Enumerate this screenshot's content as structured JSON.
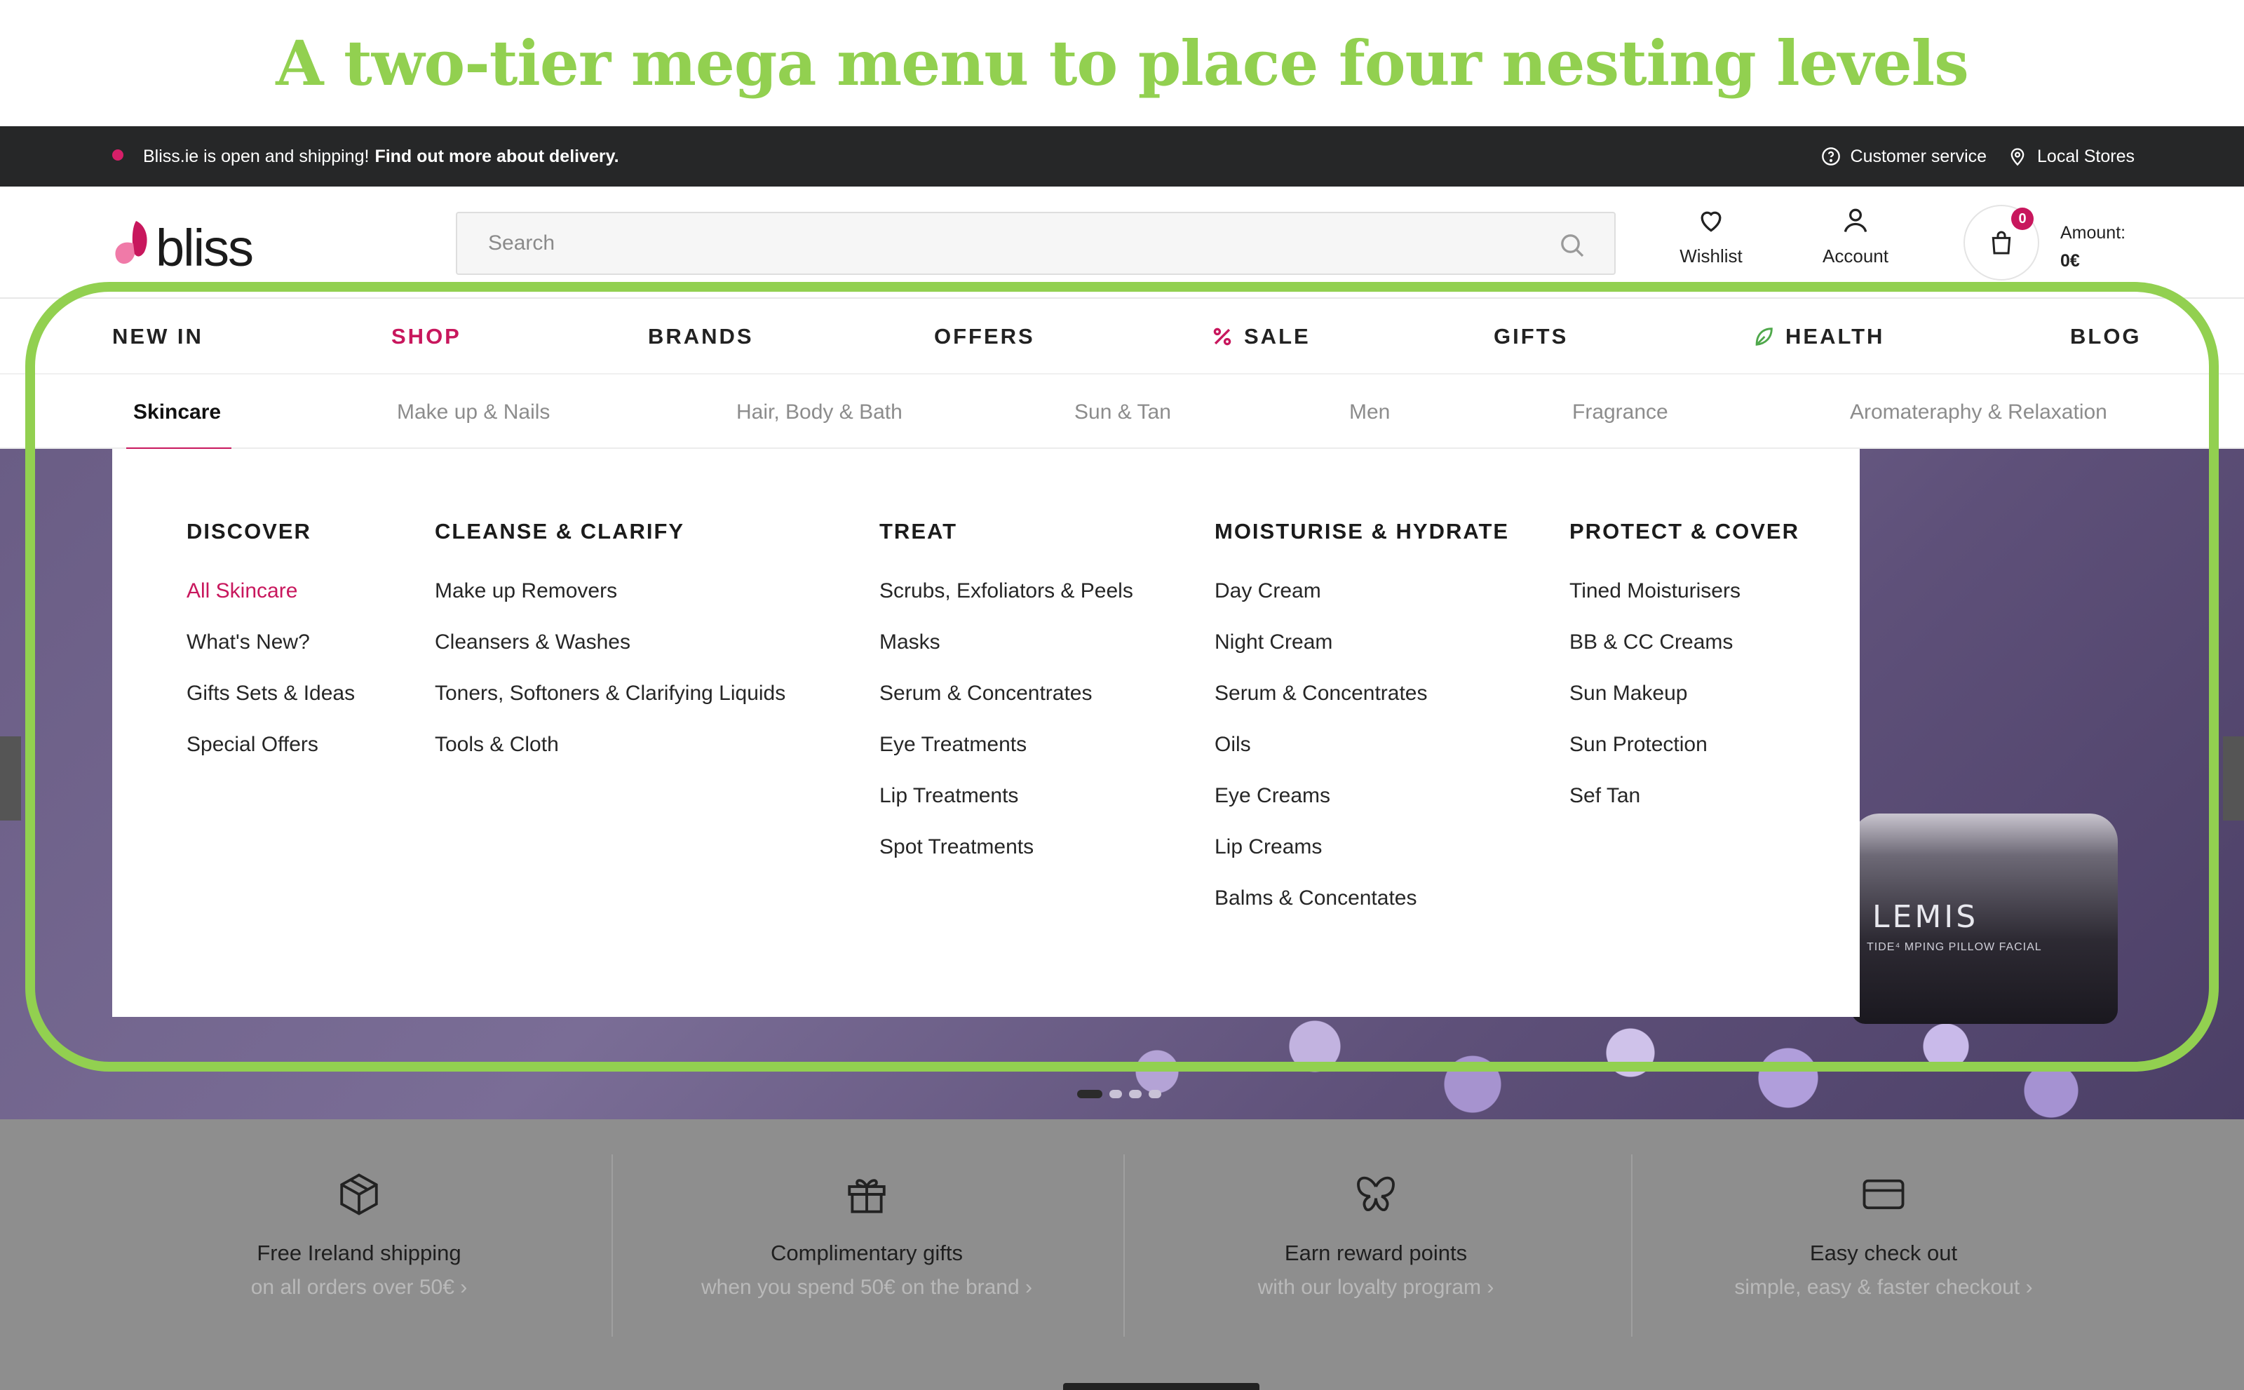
{
  "headline": "A two-tier mega menu to place four nesting levels",
  "topbar": {
    "message": "Bliss.ie is open and shipping!",
    "message_link": "Find out more about delivery.",
    "customer_service": "Customer service",
    "local_stores": "Local Stores"
  },
  "header": {
    "logo_text": "bliss",
    "search_placeholder": "Search",
    "wishlist": "Wishlist",
    "account": "Account",
    "cart_count": "0",
    "amount_label": "Amount:",
    "amount_value": "0€"
  },
  "main_nav": [
    "NEW IN",
    "SHOP",
    "BRANDS",
    "OFFERS",
    "SALE",
    "GIFTS",
    "HEALTH",
    "BLOG"
  ],
  "main_nav_active": "SHOP",
  "sub_nav": [
    "Skincare",
    "Make up & Nails",
    "Hair, Body & Bath",
    "Sun & Tan",
    "Men",
    "Fragrance",
    "Aromateraphy & Relaxation"
  ],
  "sub_nav_active": "Skincare",
  "menu_columns": [
    {
      "heading": "DISCOVER",
      "links": [
        "All Skincare",
        "What's New?",
        "Gifts Sets & Ideas",
        "Special Offers"
      ]
    },
    {
      "heading": "CLEANSE & CLARIFY",
      "links": [
        "Make up Removers",
        "Cleansers & Washes",
        "Toners, Softoners & Clarifying Liquids",
        "Tools & Cloth"
      ]
    },
    {
      "heading": "TREAT",
      "links": [
        "Scrubs, Exfoliators & Peels",
        "Masks",
        "Serum & Concentrates",
        "Eye Treatments",
        "Lip Treatments",
        "Spot Treatments"
      ]
    },
    {
      "heading": "MOISTURISE & HYDRATE",
      "links": [
        "Day Cream",
        "Night Cream",
        "Serum & Concentrates",
        "Oils",
        "Eye Creams",
        "Lip Creams",
        "Balms & Concentates"
      ]
    },
    {
      "heading": "PROTECT & COVER",
      "links": [
        "Tined Moisturisers",
        "BB & CC Creams",
        "Sun Makeup",
        "Sun Protection",
        "Sef Tan"
      ]
    }
  ],
  "hero": {
    "product_text": "LEMIS",
    "product_subtext": "TIDE⁴ MPING PILLOW FACIAL"
  },
  "benefits": [
    {
      "title": "Free Ireland shipping",
      "subtitle": "on all orders over 50€",
      "icon": "box-icon"
    },
    {
      "title": "Complimentary gifts",
      "subtitle": "when you spend 50€ on the brand",
      "icon": "gift-icon"
    },
    {
      "title": "Earn reward points",
      "subtitle": "with our loyalty program",
      "icon": "butterfly-icon"
    },
    {
      "title": "Easy check out",
      "subtitle": "simple, easy & faster checkout",
      "icon": "card-icon"
    }
  ],
  "colors": {
    "accent": "#c8175d",
    "highlight": "#92d050",
    "topbar": "#262728"
  }
}
